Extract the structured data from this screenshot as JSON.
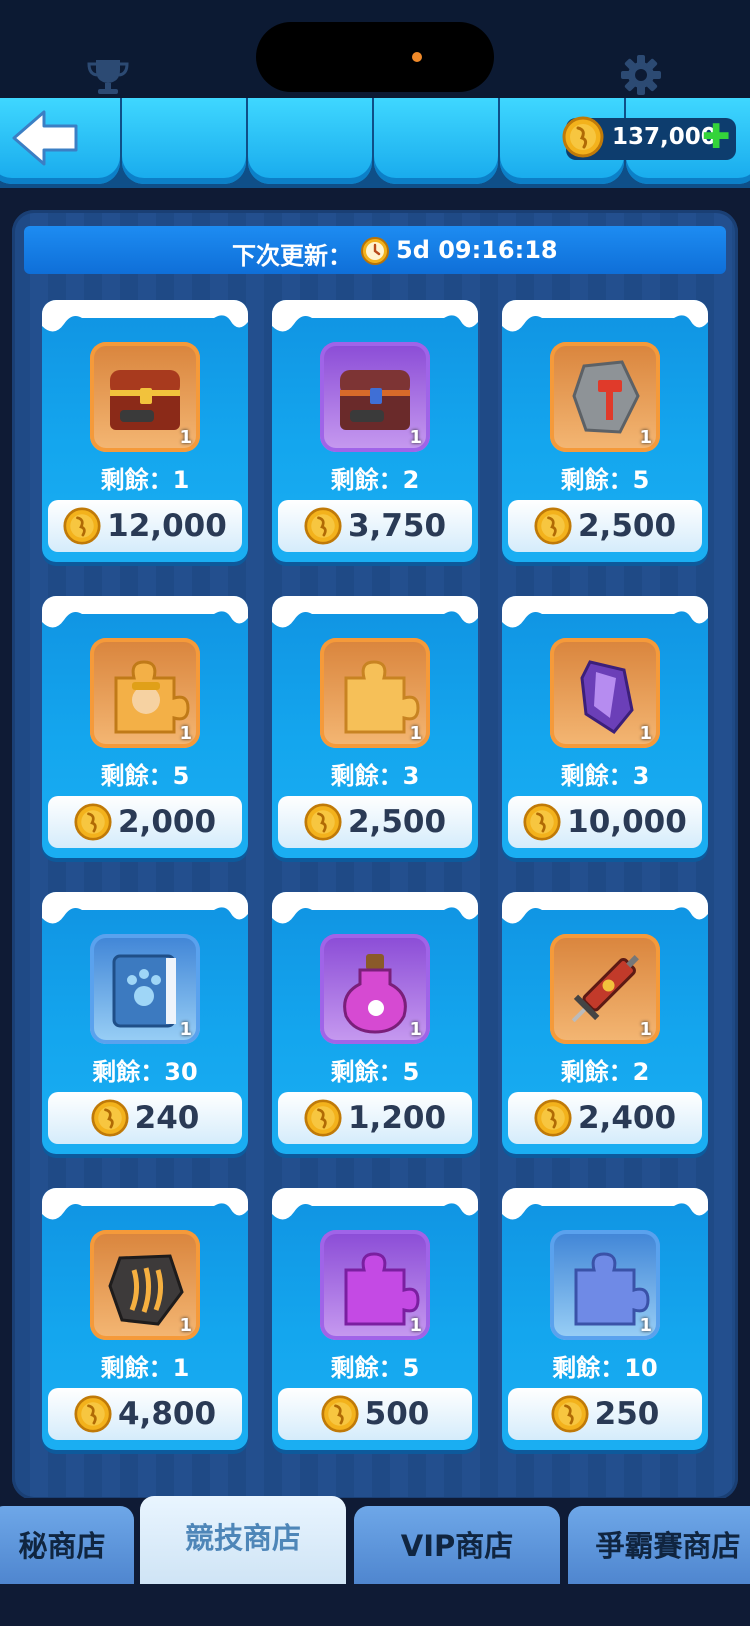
{
  "header": {
    "coins": "137,000",
    "plus_label": "✚"
  },
  "refresh": {
    "label": "下次更新：",
    "time": "5d 09:16:18"
  },
  "items": [
    {
      "name": "treasure-chest-gold",
      "frame": "orange",
      "qty": "1",
      "remain": "剩餘：1",
      "price": "12,000"
    },
    {
      "name": "treasure-chest-purple",
      "frame": "purple",
      "qty": "1",
      "remain": "剩餘：2",
      "price": "3,750"
    },
    {
      "name": "hammer-stone",
      "frame": "orange",
      "qty": "1",
      "remain": "剩餘：5",
      "price": "2,500"
    },
    {
      "name": "hero-puzzle-piece",
      "frame": "orange",
      "qty": "1",
      "remain": "剩餘：5",
      "price": "2,000"
    },
    {
      "name": "gold-puzzle-piece",
      "frame": "orange",
      "qty": "1",
      "remain": "剩餘：3",
      "price": "2,500"
    },
    {
      "name": "purple-crystal",
      "frame": "orange",
      "qty": "1",
      "remain": "剩餘：3",
      "price": "10,000"
    },
    {
      "name": "paw-book",
      "frame": "blue",
      "qty": "1",
      "remain": "剩餘：30",
      "price": "240"
    },
    {
      "name": "paw-potion",
      "frame": "purple",
      "qty": "1",
      "remain": "剩餘：5",
      "price": "1,200"
    },
    {
      "name": "paw-syringe",
      "frame": "orange",
      "qty": "1",
      "remain": "剩餘：2",
      "price": "2,400"
    },
    {
      "name": "claw-stone",
      "frame": "orange",
      "qty": "1",
      "remain": "剩餘：1",
      "price": "4,800"
    },
    {
      "name": "purple-puzzle-piece",
      "frame": "purple",
      "qty": "1",
      "remain": "剩餘：5",
      "price": "500"
    },
    {
      "name": "blue-puzzle-piece",
      "frame": "blue",
      "qty": "1",
      "remain": "剩餘：10",
      "price": "250"
    }
  ],
  "tabs": [
    {
      "label": "秘商店",
      "active": false
    },
    {
      "label": "競技商店",
      "active": true
    },
    {
      "label": "VIP商店",
      "active": false
    },
    {
      "label": "爭霸賽商店",
      "active": false
    }
  ]
}
